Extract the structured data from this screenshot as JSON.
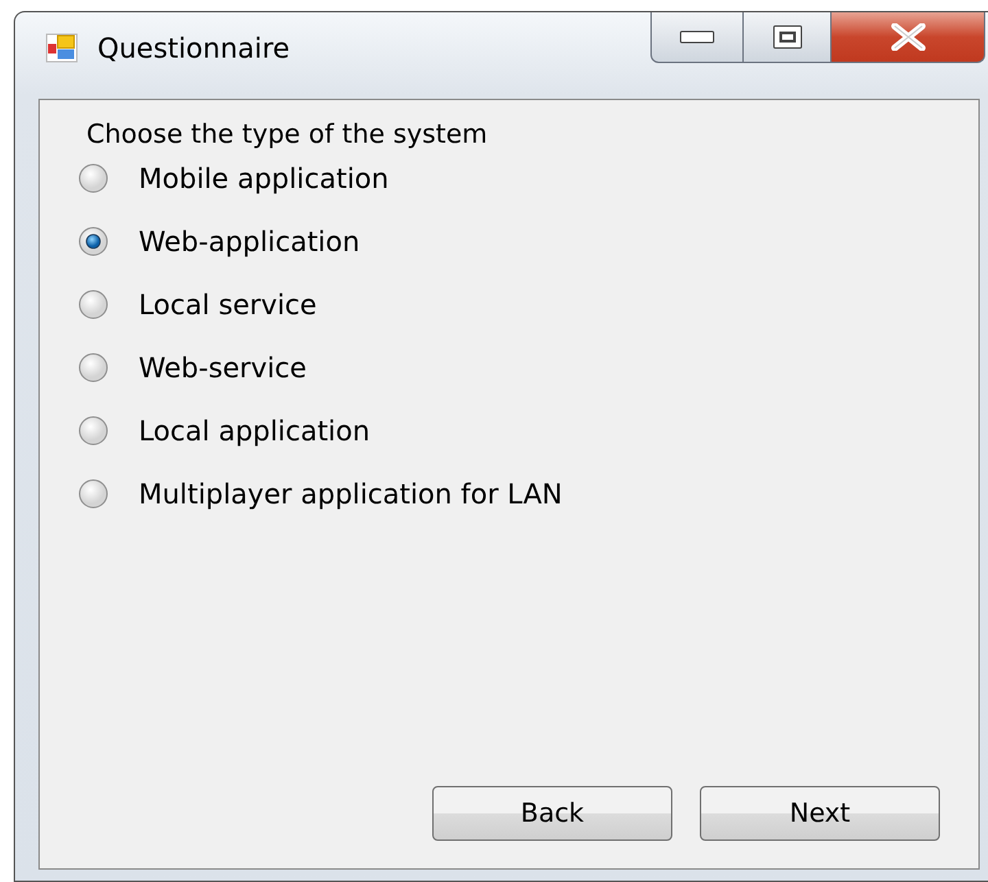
{
  "window": {
    "title": "Questionnaire"
  },
  "prompt": "Choose the type of the system",
  "options": [
    {
      "label": "Mobile application",
      "selected": false
    },
    {
      "label": "Web-application",
      "selected": true
    },
    {
      "label": "Local service",
      "selected": false
    },
    {
      "label": "Web-service",
      "selected": false
    },
    {
      "label": "Local application",
      "selected": false
    },
    {
      "label": "Multiplayer application for LAN",
      "selected": false
    }
  ],
  "buttons": [
    "Back",
    "Next"
  ]
}
